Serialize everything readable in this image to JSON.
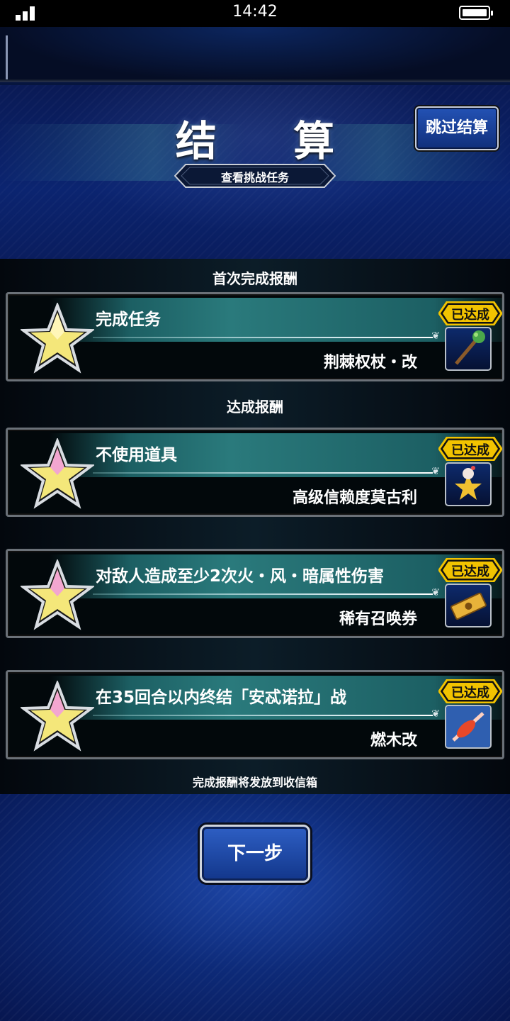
{
  "status_bar": {
    "time": "14:42"
  },
  "header": {
    "title": "结 算",
    "skip_button": "跳过结算",
    "view_tasks": "查看挑战任务"
  },
  "sections": {
    "first_clear": "首次完成报酬",
    "achievement": "达成报酬"
  },
  "missions": [
    {
      "description": "完成任务",
      "reward": "荆棘权杖・改",
      "status": "已达成",
      "reward_icon": "thorn-scepter-icon"
    },
    {
      "description": "不使用道具",
      "reward": "高级信赖度莫古利",
      "status": "已达成",
      "reward_icon": "moogle-icon"
    },
    {
      "description": "对敌人造成至少2次火・风・暗属性伤害",
      "reward": "稀有召唤券",
      "status": "已达成",
      "reward_icon": "summon-ticket-icon"
    },
    {
      "description": "在35回合以内终结「安忒诺拉」战",
      "reward": "燃木改",
      "status": "已达成",
      "reward_icon": "burning-wood-icon"
    }
  ],
  "footer_note": "完成报酬将发放到收信箱",
  "next_button": "下一步",
  "colors": {
    "badge": "#f2c300",
    "accent_blue": "#1d4fb8",
    "card_teal": "#2a7a7c"
  }
}
